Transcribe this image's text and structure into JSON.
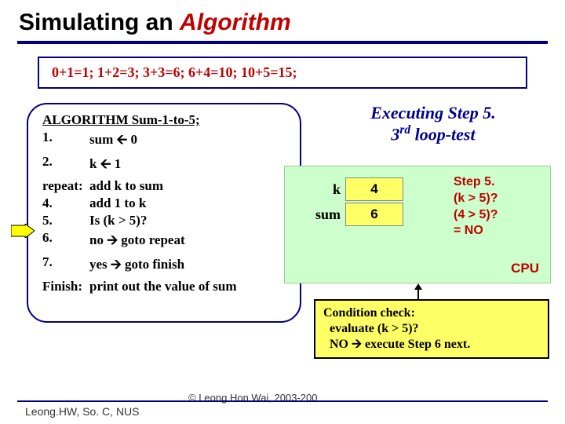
{
  "title": {
    "prefix": "Simulating an ",
    "highlight": "Algorithm"
  },
  "sequence": "0+1=1;  1+2=3;  3+3=6;  6+4=10;  10+5=15;",
  "algorithm": {
    "heading": "ALGORITHM Sum-1-to-5;",
    "steps": {
      "s1_num": "1.",
      "s1_text_a": "sum ",
      "s1_text_b": " 0",
      "s2_num": "2.",
      "s2_text_a": "k ",
      "s2_text_b": " 1",
      "srepeat_num": "repeat:",
      "srepeat_text": "add k to sum",
      "s4_num": "4.",
      "s4_text": "add 1 to k",
      "s5_num": "5.",
      "s5_text": "Is (k > 5)?",
      "s6_num": "6.",
      "s6_text_a": "  no ",
      "s6_text_b": " goto repeat",
      "s7_num": "7.",
      "s7_text_a": "  yes ",
      "s7_text_b": " goto finish",
      "sfinish_num": "Finish:",
      "sfinish_text": "print out the value of sum"
    }
  },
  "exec": {
    "line1": "Executing Step 5.",
    "line2_a": "3",
    "line2_b": "rd",
    "line2_c": " loop-test"
  },
  "cpu": {
    "k_label": "k",
    "k_value": "4",
    "sum_label": "sum",
    "sum_value": "6",
    "step5_l1": "Step 5.",
    "step5_l2": "(k > 5)?",
    "step5_l3": "(4 > 5)?",
    "step5_l4": "= NO",
    "label": "CPU"
  },
  "condition": {
    "l1": "Condition check:",
    "l2": "  evaluate (k > 5)?",
    "l3_a": "  NO ",
    "l3_b": " execute Step 6 next."
  },
  "copyright": "© Leong Hon Wai, 2003-200",
  "footer": "Leong.HW, So. C, NUS"
}
